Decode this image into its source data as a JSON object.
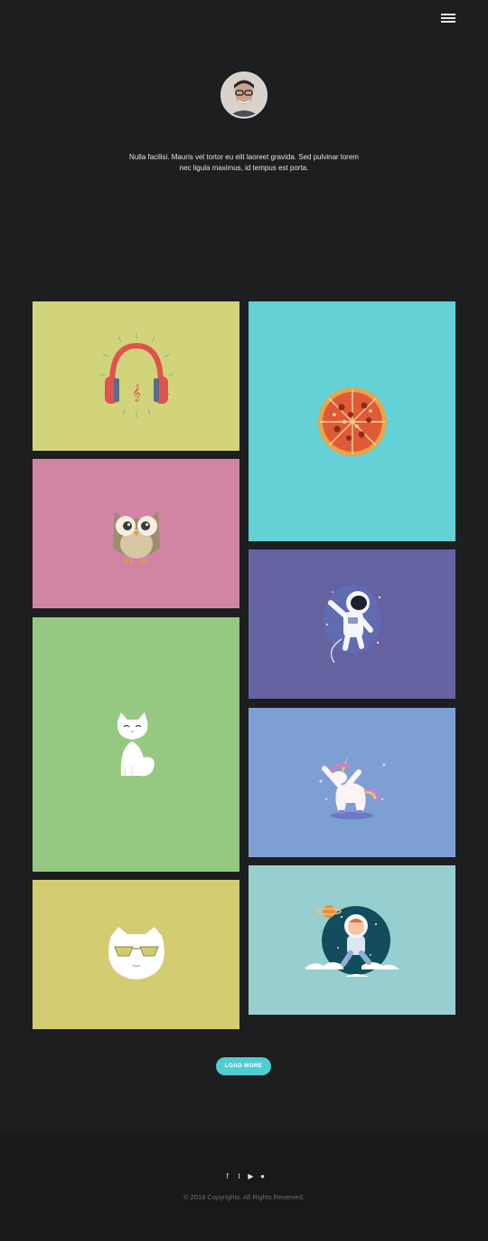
{
  "header": {
    "menu_icon": "hamburger-menu-icon"
  },
  "profile": {
    "avatar_icon": "portrait-avatar",
    "intro": "Nulla facilisi. Mauris vel tortor eu elit laoreet gravida. Sed pulvinar lorem nec ligula maximus, id tempus est porta."
  },
  "gallery": {
    "items": [
      {
        "illustration": "headphones-icon",
        "color": "#d1d47a"
      },
      {
        "illustration": "pizza-icon",
        "color": "#63d1d5"
      },
      {
        "illustration": "owl-icon",
        "color": "#d184a4"
      },
      {
        "illustration": "astronaut-icon",
        "color": "#6562a1"
      },
      {
        "illustration": "white-cat-icon",
        "color": "#95c981"
      },
      {
        "illustration": "dabbing-unicorn-icon",
        "color": "#7d9fd3"
      },
      {
        "illustration": "cool-cat-icon",
        "color": "#d3cc70"
      },
      {
        "illustration": "space-kid-icon",
        "color": "#97ced0"
      }
    ]
  },
  "actions": {
    "load_more_label": "LOAD MORE"
  },
  "footer": {
    "social": {
      "facebook": "f",
      "twitter": "t",
      "youtube": "▶",
      "github": "●"
    },
    "copyright": "© 2018 Copyrights. All Rights Reserved."
  },
  "colors": {
    "background": "#1d1e20",
    "footer": "#19191b",
    "accent": "#50cdd2"
  }
}
